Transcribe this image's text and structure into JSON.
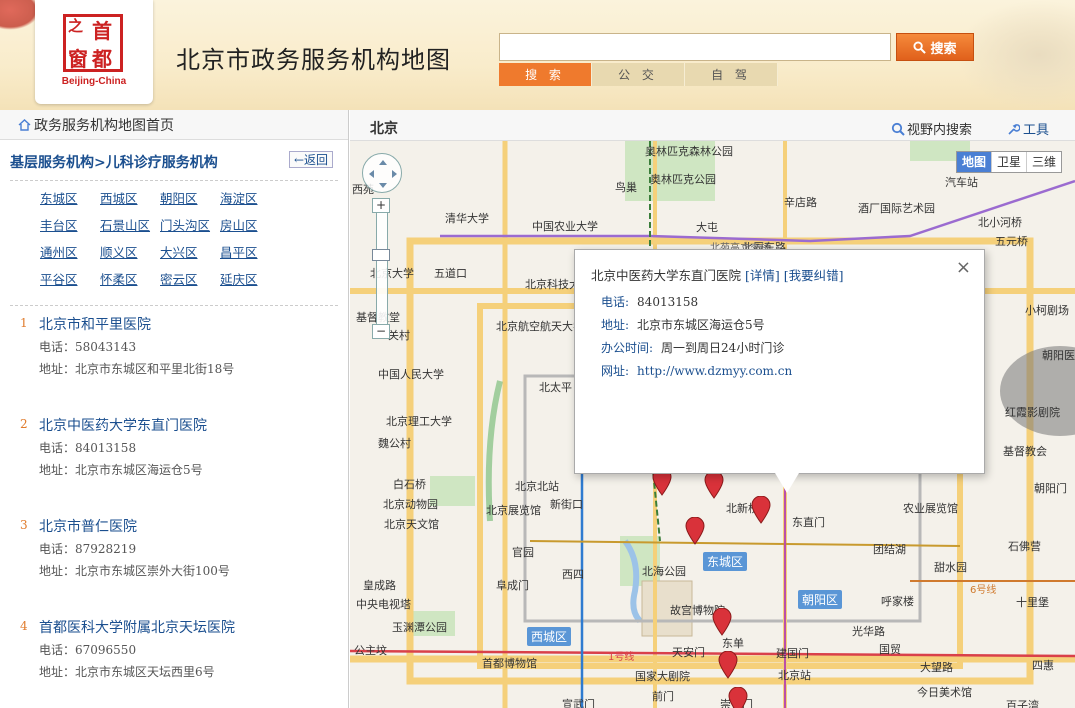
{
  "header": {
    "site_title": "北京市政务服务机构地图",
    "logo_chars": [
      "首",
      "都",
      "之",
      "窗"
    ],
    "logo_caption": "Beijing-China",
    "search_value": "",
    "search_button": "搜索",
    "tabs": [
      "搜 索",
      "公 交",
      "自 驾"
    ]
  },
  "left": {
    "home_link": "政务服务机构地图首页",
    "breadcrumb": "基层服务机构>儿科诊疗服务机构",
    "back": "返回",
    "districts": [
      "东城区",
      "西城区",
      "朝阳区",
      "海淀区",
      "丰台区",
      "石景山区",
      "门头沟区",
      "房山区",
      "通州区",
      "顺义区",
      "大兴区",
      "昌平区",
      "平谷区",
      "怀柔区",
      "密云区",
      "延庆区"
    ],
    "entries": [
      {
        "num": "1",
        "name": "北京市和平里医院",
        "phone": "电话：58043143",
        "address": "地址：北京市东城区和平里北街18号"
      },
      {
        "num": "2",
        "name": "北京中医药大学东直门医院",
        "phone": "电话：84013158",
        "address": "地址：北京市东城区海运仓5号"
      },
      {
        "num": "3",
        "name": "北京市普仁医院",
        "phone": "电话：87928219",
        "address": "地址：北京市东城区崇外大街100号"
      },
      {
        "num": "4",
        "name": "首都医科大学附属北京天坛医院",
        "phone": "电话：67096550",
        "address": "地址：北京市东城区天坛西里6号"
      }
    ]
  },
  "map": {
    "city": "北京",
    "view_search": "视野内搜索",
    "tools": "工具",
    "map_types": [
      "地图",
      "卫星",
      "三维"
    ],
    "labels": [
      "西苑",
      "清华大学",
      "中国农业大学",
      "奥林匹克森林公园",
      "奥林匹克公园",
      "鸟巢",
      "辛店路",
      "北辰东路",
      "大屯",
      "北苑高立交桥",
      "五道口",
      "北京科技大学",
      "北京大学",
      "基督教堂",
      "关村",
      "北京航空航天大学",
      "中国人民大学",
      "北太平",
      "北京理工大学",
      "魏公村",
      "白石桥",
      "北京北站",
      "北京动物园",
      "北京展览馆",
      "新街口",
      "北京天文馆",
      "北新桥",
      "东直门",
      "官园",
      "西四",
      "北海公园",
      "东城区",
      "皇成路",
      "阜成门",
      "故宫博物院",
      "中央电视塔",
      "玉渊潭公园",
      "西城区",
      "东单",
      "公主坟",
      "首都博物馆",
      "1号线",
      "天安门",
      "建国门",
      "国家大剧院",
      "北京站",
      "前门",
      "崇文门",
      "宣武门",
      "酒厂国际艺术园",
      "汽车站",
      "北小河桥",
      "五元桥",
      "小柯剧场",
      "红霞影剧院",
      "基督教会",
      "朝阳门",
      "农业展览馆",
      "团结湖",
      "石佛营",
      "甜水园",
      "朝阳区",
      "呼家楼",
      "6号线",
      "十里堡",
      "光华路",
      "国贸",
      "大望路",
      "四惠",
      "今日美术馆",
      "百子湾",
      "朝阳医院"
    ]
  },
  "popup": {
    "title": "北京中医药大学东直门医院",
    "detail": "[详情]",
    "report": "[我要纠错]",
    "close": "×",
    "phone_key": "电话:",
    "phone": "84013158",
    "addr_key": "地址:",
    "addr": "北京市东城区海运仓5号",
    "hours_key": "办公时间:",
    "hours": "周一到周日24小时门诊",
    "url_key": "网址:",
    "url": "http://www.dzmyy.com.cn"
  }
}
